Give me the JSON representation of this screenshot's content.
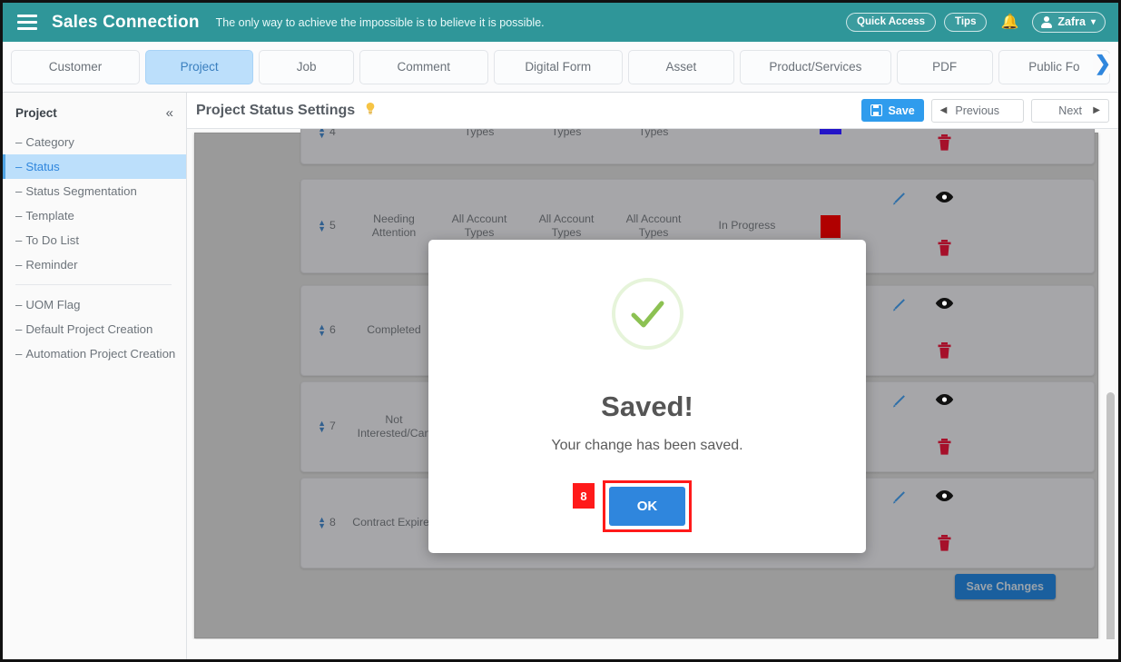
{
  "header": {
    "menu_icon": "hamburger-icon",
    "brand": "Sales Connection",
    "tagline": "The only way to achieve the impossible is to believe it is possible.",
    "quick_access": "Quick Access",
    "tips": "Tips",
    "bell_icon": "bell-icon",
    "user_name": "Zafra",
    "user_caret": "▾"
  },
  "tabs": [
    {
      "label": "Customer",
      "active": false
    },
    {
      "label": "Project",
      "active": true
    },
    {
      "label": "Job",
      "active": false
    },
    {
      "label": "Comment",
      "active": false
    },
    {
      "label": "Digital Form",
      "active": false
    },
    {
      "label": "Asset",
      "active": false
    },
    {
      "label": "Product/Services",
      "active": false
    },
    {
      "label": "PDF",
      "active": false
    },
    {
      "label": "Public Fo",
      "active": false
    }
  ],
  "tabs_next_icon": "❯",
  "sidebar": {
    "title": "Project",
    "collapse_icon": "«",
    "items": [
      {
        "label": "Category",
        "active": false
      },
      {
        "label": "Status",
        "active": true
      },
      {
        "label": "Status Segmentation",
        "active": false
      },
      {
        "label": "Template",
        "active": false
      },
      {
        "label": "To Do List",
        "active": false
      },
      {
        "label": "Reminder",
        "active": false
      }
    ],
    "items2": [
      {
        "label": "UOM Flag",
        "active": false
      },
      {
        "label": "Default Project Creation",
        "active": false
      },
      {
        "label": "Automation Project Creation",
        "active": false
      }
    ],
    "dash": "–"
  },
  "page": {
    "title": "Project Status Settings",
    "bulb_icon": "💡",
    "save_label": "Save",
    "previous_label": "Previous",
    "next_label": "Next",
    "previous_arrow": "◀",
    "next_arrow": "▶",
    "save_changes_label": "Save Changes"
  },
  "table": {
    "rows": [
      {
        "order": "4",
        "name": "",
        "account_type_1": "Types",
        "account_type_2": "Types",
        "account_type_3": "Types",
        "status": "",
        "color": "#2314c8"
      },
      {
        "order": "5",
        "name": "Needing Attention",
        "account_type_1": "All Account Types",
        "account_type_2": "All Account Types",
        "account_type_3": "All Account Types",
        "status": "In Progress",
        "color": "#b00000"
      },
      {
        "order": "6",
        "name": "Completed",
        "account_type_1": "",
        "account_type_2": "",
        "account_type_3": "",
        "status": "",
        "color": ""
      },
      {
        "order": "7",
        "name": "Not Interested/Can",
        "account_type_1": "",
        "account_type_2": "",
        "account_type_3": "",
        "status": "",
        "color": ""
      },
      {
        "order": "8",
        "name": "Contract Expired",
        "account_type_1": "",
        "account_type_2": "",
        "account_type_3": "",
        "status": "",
        "color": ""
      }
    ],
    "icons": {
      "sort": "sort-updown-icon",
      "edit": "pencil-edit-icon",
      "view": "eye-view-icon",
      "delete": "trash-delete-icon"
    }
  },
  "modal": {
    "icon": "success-check-icon",
    "title": "Saved!",
    "message": "Your change has been saved.",
    "ok_label": "OK",
    "step_number": "8"
  },
  "colors": {
    "brand_teal": "#2f9699",
    "accent_blue": "#2f86dd",
    "highlight_red": "#ff1a1a",
    "success_green": "#8cc152"
  }
}
